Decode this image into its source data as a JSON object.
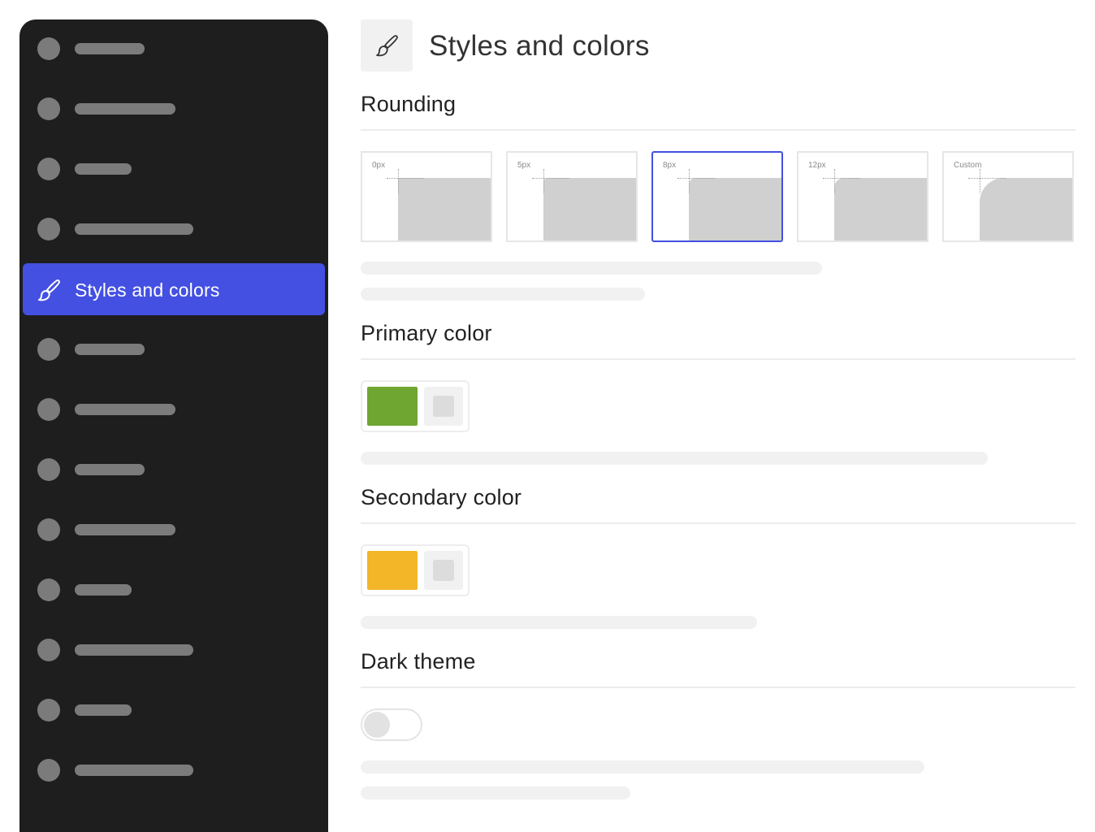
{
  "sidebar": {
    "active_item": {
      "label": "Styles and colors",
      "icon": "brush-icon"
    },
    "active_color": "#4350e2",
    "background_color": "#1e1e1e"
  },
  "header": {
    "title": "Styles and colors",
    "icon": "brush-icon"
  },
  "rounding": {
    "title": "Rounding",
    "options": [
      {
        "label": "0px",
        "radius": 0,
        "selected": false
      },
      {
        "label": "5px",
        "radius": 5,
        "selected": false
      },
      {
        "label": "8px",
        "radius": 8,
        "selected": true
      },
      {
        "label": "12px",
        "radius": 12,
        "selected": false
      },
      {
        "label": "Custom",
        "radius": 30,
        "selected": false
      }
    ]
  },
  "primary_color": {
    "title": "Primary color",
    "value": "#6fa632"
  },
  "secondary_color": {
    "title": "Secondary color",
    "value": "#f2b628"
  },
  "dark_theme": {
    "title": "Dark theme",
    "enabled": false
  }
}
